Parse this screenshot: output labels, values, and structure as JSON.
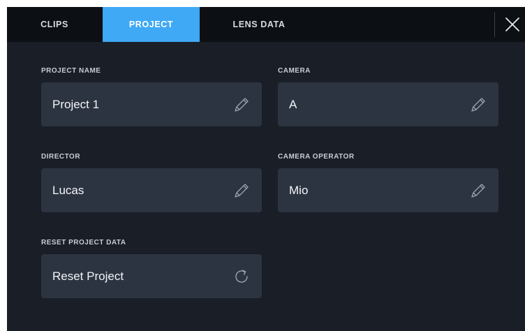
{
  "tabs": {
    "clips": "CLIPS",
    "project": "PROJECT",
    "lens_data": "LENS DATA"
  },
  "active_tab": "PROJECT",
  "accent_color": "#3fa9f5",
  "fields": {
    "project_name": {
      "label": "PROJECT NAME",
      "value": "Project 1",
      "icon": "pencil-icon"
    },
    "camera": {
      "label": "CAMERA",
      "value": "A",
      "icon": "pencil-icon"
    },
    "director": {
      "label": "DIRECTOR",
      "value": "Lucas",
      "icon": "pencil-icon"
    },
    "camera_operator": {
      "label": "CAMERA OPERATOR",
      "value": "Mio",
      "icon": "pencil-icon"
    }
  },
  "reset": {
    "label": "RESET PROJECT DATA",
    "button_label": "Reset Project",
    "icon": "reset-icon"
  },
  "close_icon": "close-icon"
}
